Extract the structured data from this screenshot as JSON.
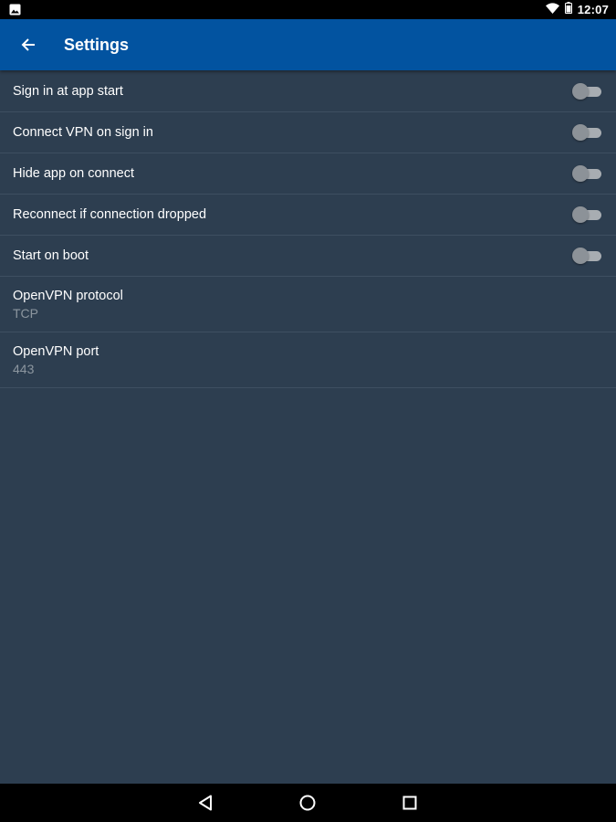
{
  "status_bar": {
    "time": "12:07",
    "icons": [
      "gallery-icon",
      "wifi-icon",
      "battery-icon"
    ]
  },
  "app_bar": {
    "title": "Settings",
    "back_icon": "arrow-back-icon",
    "color": "#0253a0"
  },
  "settings": {
    "toggles": [
      {
        "label": "Sign in at app start",
        "enabled": false
      },
      {
        "label": "Connect VPN on sign in",
        "enabled": false
      },
      {
        "label": "Hide app on connect",
        "enabled": false
      },
      {
        "label": "Reconnect if connection dropped",
        "enabled": false
      },
      {
        "label": "Start on boot",
        "enabled": false
      }
    ],
    "protocol": {
      "label": "OpenVPN protocol",
      "value": "TCP"
    },
    "port": {
      "label": "OpenVPN port",
      "value": "443"
    }
  },
  "nav_bar": {
    "buttons": [
      "back-triangle-icon",
      "home-circle-icon",
      "recents-square-icon"
    ]
  },
  "colors": {
    "background": "#2d3e50",
    "divider": "#3e4f61",
    "secondary_text": "#8c969f"
  }
}
